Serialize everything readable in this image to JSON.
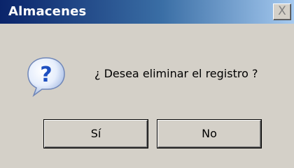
{
  "dialog": {
    "title": "Almacenes",
    "close_label": "X",
    "message": "¿ Desea eliminar el registro ?",
    "icon": "question-icon",
    "yes_label": "Sí",
    "no_label": "No"
  },
  "colors": {
    "titlebar_start": "#0a246a",
    "titlebar_end": "#a6caf0",
    "face": "#d4d0c8",
    "icon_blue": "#1e4fc0"
  }
}
